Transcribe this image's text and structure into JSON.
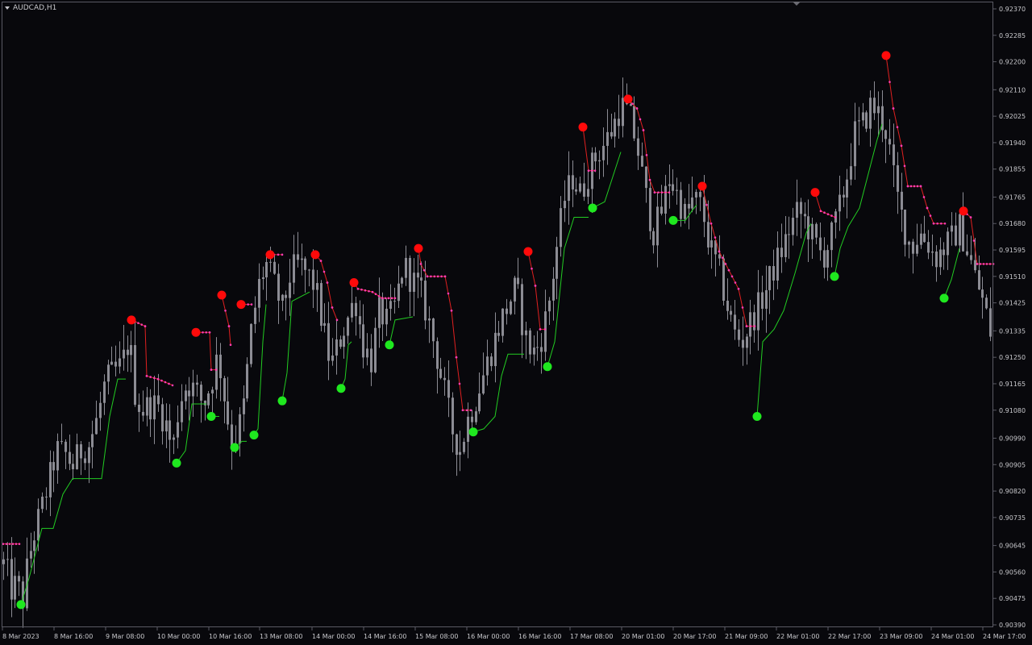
{
  "window": {
    "symbol_title": "AUDCAD,H1",
    "dropdown_icon": "triangle-down-icon"
  },
  "colors": {
    "background": "#08080c",
    "candle": "#8c8c94",
    "uptrend": "#22cc22",
    "downtrend": "#e02020",
    "dots": "#ff3db4",
    "signal_buy": "#1fe81f",
    "signal_sell": "#ff0a0a",
    "text": "#c8c8cc",
    "border": "#5a5a64"
  },
  "chart_data": {
    "type": "candlestick",
    "symbol": "AUDCAD",
    "timeframe": "H1",
    "ylim": [
      0.9039,
      0.9237
    ],
    "y_ticks": [
      "0.92370",
      "0.92285",
      "0.92200",
      "0.92110",
      "0.92025",
      "0.91940",
      "0.91855",
      "0.91765",
      "0.91680",
      "0.91595",
      "0.91510",
      "0.91425",
      "0.91335",
      "0.91250",
      "0.91165",
      "0.91080",
      "0.90990",
      "0.90905",
      "0.90820",
      "0.90735",
      "0.90645",
      "0.90560",
      "0.90475",
      "0.90390"
    ],
    "x_ticks": [
      "8 Mar 2023",
      "8 Mar 16:00",
      "9 Mar 08:00",
      "10 Mar 00:00",
      "10 Mar 16:00",
      "13 Mar 08:00",
      "14 Mar 00:00",
      "14 Mar 16:00",
      "15 Mar 08:00",
      "16 Mar 00:00",
      "16 Mar 16:00",
      "17 Mar 08:00",
      "20 Mar 01:00",
      "20 Mar 17:00",
      "21 Mar 09:00",
      "22 Mar 01:00",
      "22 Mar 17:00",
      "23 Mar 09:00",
      "24 Mar 01:00",
      "24 Mar 17:00"
    ],
    "price_path": [
      [
        0,
        0.9061
      ],
      [
        8,
        0.9056
      ],
      [
        14,
        0.905
      ],
      [
        20,
        0.9052
      ],
      [
        28,
        0.9047
      ],
      [
        34,
        0.9059
      ],
      [
        42,
        0.9068
      ],
      [
        50,
        0.9075
      ],
      [
        60,
        0.9085
      ],
      [
        70,
        0.9095
      ],
      [
        80,
        0.9094
      ],
      [
        90,
        0.909
      ],
      [
        100,
        0.9095
      ],
      [
        110,
        0.9097
      ],
      [
        120,
        0.9105
      ],
      [
        130,
        0.9117
      ],
      [
        140,
        0.912
      ],
      [
        150,
        0.9122
      ],
      [
        160,
        0.9131
      ],
      [
        168,
        0.9112
      ],
      [
        176,
        0.9108
      ],
      [
        186,
        0.911
      ],
      [
        196,
        0.9109
      ],
      [
        206,
        0.9103
      ],
      [
        214,
        0.9095
      ],
      [
        222,
        0.9111
      ],
      [
        232,
        0.9117
      ],
      [
        242,
        0.9114
      ],
      [
        252,
        0.911
      ],
      [
        262,
        0.9117
      ],
      [
        270,
        0.9126
      ],
      [
        278,
        0.9112
      ],
      [
        286,
        0.9099
      ],
      [
        294,
        0.91
      ],
      [
        302,
        0.911
      ],
      [
        312,
        0.9135
      ],
      [
        322,
        0.915
      ],
      [
        330,
        0.9155
      ],
      [
        340,
        0.9148
      ],
      [
        350,
        0.914
      ],
      [
        360,
        0.9152
      ],
      [
        370,
        0.9155
      ],
      [
        380,
        0.9152
      ],
      [
        390,
        0.9148
      ],
      [
        400,
        0.9135
      ],
      [
        410,
        0.9122
      ],
      [
        420,
        0.913
      ],
      [
        430,
        0.9137
      ],
      [
        440,
        0.9144
      ],
      [
        450,
        0.9129
      ],
      [
        460,
        0.9124
      ],
      [
        470,
        0.914
      ],
      [
        480,
        0.9136
      ],
      [
        490,
        0.9142
      ],
      [
        500,
        0.9155
      ],
      [
        510,
        0.915
      ],
      [
        520,
        0.9147
      ],
      [
        530,
        0.9138
      ],
      [
        540,
        0.9127
      ],
      [
        550,
        0.9115
      ],
      [
        560,
        0.9102
      ],
      [
        570,
        0.9095
      ],
      [
        580,
        0.9105
      ],
      [
        590,
        0.9112
      ],
      [
        600,
        0.912
      ],
      [
        610,
        0.9128
      ],
      [
        620,
        0.9136
      ],
      [
        630,
        0.9142
      ],
      [
        640,
        0.9148
      ],
      [
        650,
        0.9132
      ],
      [
        660,
        0.9126
      ],
      [
        670,
        0.913
      ],
      [
        680,
        0.9142
      ],
      [
        690,
        0.916
      ],
      [
        700,
        0.9176
      ],
      [
        710,
        0.9183
      ],
      [
        720,
        0.9177
      ],
      [
        730,
        0.9185
      ],
      [
        740,
        0.919
      ],
      [
        750,
        0.9194
      ],
      [
        760,
        0.9199
      ],
      [
        770,
        0.9206
      ],
      [
        780,
        0.9203
      ],
      [
        790,
        0.9193
      ],
      [
        800,
        0.9177
      ],
      [
        810,
        0.9165
      ],
      [
        820,
        0.9172
      ],
      [
        830,
        0.9183
      ],
      [
        840,
        0.9177
      ],
      [
        850,
        0.917
      ],
      [
        860,
        0.9176
      ],
      [
        870,
        0.9173
      ],
      [
        880,
        0.916
      ],
      [
        890,
        0.9154
      ],
      [
        900,
        0.9143
      ],
      [
        910,
        0.9133
      ],
      [
        920,
        0.913
      ],
      [
        930,
        0.9136
      ],
      [
        940,
        0.9141
      ],
      [
        950,
        0.9147
      ],
      [
        960,
        0.9154
      ],
      [
        970,
        0.916
      ],
      [
        980,
        0.9167
      ],
      [
        990,
        0.9172
      ],
      [
        1000,
        0.9168
      ],
      [
        1010,
        0.9162
      ],
      [
        1020,
        0.9157
      ],
      [
        1030,
        0.9163
      ],
      [
        1040,
        0.9172
      ],
      [
        1050,
        0.9183
      ],
      [
        1060,
        0.9197
      ],
      [
        1070,
        0.92
      ],
      [
        1080,
        0.9206
      ],
      [
        1090,
        0.9203
      ],
      [
        1100,
        0.9197
      ],
      [
        1110,
        0.9179
      ],
      [
        1120,
        0.9168
      ],
      [
        1130,
        0.916
      ],
      [
        1140,
        0.9165
      ],
      [
        1150,
        0.9162
      ],
      [
        1160,
        0.9157
      ],
      [
        1170,
        0.916
      ],
      [
        1180,
        0.9163
      ],
      [
        1190,
        0.9167
      ],
      [
        1200,
        0.9159
      ],
      [
        1210,
        0.915
      ],
      [
        1220,
        0.9142
      ],
      [
        1230,
        0.9131
      ]
    ],
    "trend_segments": [
      {
        "dir": "up",
        "points": [
          [
            26,
            0.90455
          ],
          [
            36,
            0.9054
          ],
          [
            52,
            0.907
          ],
          [
            66,
            0.907
          ],
          [
            78,
            0.9081
          ],
          [
            90,
            0.9086
          ],
          [
            112,
            0.9086
          ],
          [
            126,
            0.9086
          ],
          [
            136,
            0.9106
          ],
          [
            146,
            0.9118
          ],
          [
            156,
            0.9118
          ]
        ]
      },
      {
        "dir": "down",
        "points": [
          [
            4,
            0.9065
          ],
          [
            24,
            0.9065
          ]
        ]
      },
      {
        "dir": "down",
        "points": [
          [
            163,
            0.9137
          ],
          [
            180,
            0.9135
          ],
          [
            182,
            0.9119
          ],
          [
            196,
            0.9118
          ],
          [
            214,
            0.9116
          ]
        ]
      },
      {
        "dir": "up",
        "points": [
          [
            219,
            0.9091
          ],
          [
            230,
            0.9095
          ],
          [
            238,
            0.911
          ],
          [
            256,
            0.911
          ]
        ]
      },
      {
        "dir": "down",
        "points": [
          [
            243,
            0.9133
          ],
          [
            260,
            0.9133
          ],
          [
            262,
            0.9121
          ],
          [
            268,
            0.9121
          ]
        ]
      },
      {
        "dir": "up",
        "points": [
          [
            262,
            0.9106
          ],
          [
            272,
            0.9106
          ]
        ]
      },
      {
        "dir": "down",
        "points": [
          [
            275,
            0.9145
          ],
          [
            284,
            0.9135
          ],
          [
            286,
            0.9129
          ]
        ]
      },
      {
        "dir": "up",
        "points": [
          [
            291,
            0.9096
          ],
          [
            300,
            0.9098
          ],
          [
            306,
            0.9098
          ]
        ]
      },
      {
        "dir": "down",
        "points": [
          [
            299,
            0.9142
          ],
          [
            312,
            0.9142
          ]
        ]
      },
      {
        "dir": "up",
        "points": [
          [
            315,
            0.91
          ],
          [
            320,
            0.9102
          ],
          [
            326,
            0.913
          ],
          [
            330,
            0.9142
          ]
        ]
      },
      {
        "dir": "down",
        "points": [
          [
            335,
            0.9158
          ],
          [
            350,
            0.9158
          ]
        ]
      },
      {
        "dir": "up",
        "points": [
          [
            350,
            0.9111
          ],
          [
            356,
            0.912
          ],
          [
            362,
            0.9143
          ],
          [
            384,
            0.9146
          ]
        ]
      },
      {
        "dir": "down",
        "points": [
          [
            391,
            0.9158
          ],
          [
            398,
            0.9156
          ],
          [
            406,
            0.9149
          ],
          [
            412,
            0.9141
          ],
          [
            418,
            0.9137
          ]
        ]
      },
      {
        "dir": "up",
        "points": [
          [
            423,
            0.9115
          ],
          [
            428,
            0.9118
          ],
          [
            432,
            0.9129
          ],
          [
            436,
            0.913
          ]
        ]
      },
      {
        "dir": "down",
        "points": [
          [
            439,
            0.9149
          ],
          [
            444,
            0.9147
          ],
          [
            462,
            0.9146
          ],
          [
            474,
            0.9144
          ],
          [
            490,
            0.9144
          ]
        ]
      },
      {
        "dir": "up",
        "points": [
          [
            483,
            0.9129
          ],
          [
            490,
            0.9137
          ],
          [
            512,
            0.9138
          ]
        ]
      },
      {
        "dir": "down",
        "points": [
          [
            519,
            0.916
          ],
          [
            522,
            0.9155
          ],
          [
            530,
            0.9151
          ],
          [
            552,
            0.9151
          ],
          [
            560,
            0.914
          ],
          [
            566,
            0.9125
          ],
          [
            574,
            0.9108
          ],
          [
            584,
            0.9108
          ]
        ]
      },
      {
        "dir": "up",
        "points": [
          [
            587,
            0.9101
          ],
          [
            600,
            0.9102
          ],
          [
            614,
            0.9106
          ],
          [
            622,
            0.9119
          ],
          [
            630,
            0.9126
          ],
          [
            650,
            0.9126
          ]
        ]
      },
      {
        "dir": "down",
        "points": [
          [
            655,
            0.9159
          ],
          [
            664,
            0.9148
          ],
          [
            670,
            0.9134
          ],
          [
            676,
            0.9134
          ]
        ]
      },
      {
        "dir": "up",
        "points": [
          [
            679,
            0.9122
          ],
          [
            688,
            0.913
          ],
          [
            700,
            0.916
          ],
          [
            712,
            0.917
          ],
          [
            730,
            0.917
          ]
        ]
      },
      {
        "dir": "down",
        "points": [
          [
            723,
            0.9199
          ],
          [
            730,
            0.9185
          ],
          [
            738,
            0.9185
          ]
        ]
      },
      {
        "dir": "up",
        "points": [
          [
            735,
            0.9173
          ],
          [
            750,
            0.9175
          ],
          [
            760,
            0.9183
          ],
          [
            770,
            0.9191
          ]
        ]
      },
      {
        "dir": "down",
        "points": [
          [
            779,
            0.9208
          ],
          [
            790,
            0.9205
          ],
          [
            798,
            0.9198
          ],
          [
            806,
            0.9182
          ],
          [
            812,
            0.9178
          ],
          [
            830,
            0.9178
          ]
        ]
      },
      {
        "dir": "up",
        "points": [
          [
            835,
            0.9169
          ],
          [
            850,
            0.9169
          ],
          [
            858,
            0.9172
          ],
          [
            864,
            0.9174
          ]
        ]
      },
      {
        "dir": "down",
        "points": [
          [
            871,
            0.918
          ],
          [
            882,
            0.9168
          ],
          [
            892,
            0.9159
          ],
          [
            904,
            0.9153
          ],
          [
            916,
            0.9147
          ],
          [
            926,
            0.9135
          ],
          [
            936,
            0.9135
          ]
        ]
      },
      {
        "dir": "up",
        "points": [
          [
            939,
            0.9106
          ],
          [
            946,
            0.913
          ],
          [
            960,
            0.9134
          ],
          [
            972,
            0.914
          ],
          [
            986,
            0.9152
          ],
          [
            1000,
            0.9165
          ],
          [
            1006,
            0.9168
          ]
        ]
      },
      {
        "dir": "down",
        "points": [
          [
            1011,
            0.9178
          ],
          [
            1018,
            0.9172
          ],
          [
            1036,
            0.917
          ]
        ]
      },
      {
        "dir": "up",
        "points": [
          [
            1035,
            0.9151
          ],
          [
            1042,
            0.916
          ],
          [
            1052,
            0.9167
          ],
          [
            1066,
            0.9173
          ],
          [
            1078,
            0.9185
          ],
          [
            1088,
            0.9195
          ],
          [
            1094,
            0.92
          ]
        ]
      },
      {
        "dir": "down",
        "points": [
          [
            1099,
            0.9222
          ],
          [
            1108,
            0.9205
          ],
          [
            1118,
            0.9193
          ],
          [
            1126,
            0.918
          ],
          [
            1142,
            0.918
          ],
          [
            1150,
            0.9173
          ],
          [
            1158,
            0.9168
          ],
          [
            1172,
            0.9168
          ]
        ]
      },
      {
        "dir": "up",
        "points": [
          [
            1171,
            0.9144
          ],
          [
            1180,
            0.915
          ],
          [
            1190,
            0.916
          ]
        ]
      },
      {
        "dir": "down",
        "points": [
          [
            1195,
            0.9172
          ],
          [
            1204,
            0.917
          ],
          [
            1212,
            0.9155
          ],
          [
            1232,
            0.9155
          ]
        ]
      }
    ],
    "buy_signals": [
      [
        26,
        0.90455
      ],
      [
        219,
        0.9091
      ],
      [
        262,
        0.9106
      ],
      [
        291,
        0.9096
      ],
      [
        315,
        0.91
      ],
      [
        350,
        0.9111
      ],
      [
        423,
        0.9115
      ],
      [
        483,
        0.9129
      ],
      [
        587,
        0.9101
      ],
      [
        679,
        0.9122
      ],
      [
        735,
        0.9173
      ],
      [
        835,
        0.9169
      ],
      [
        939,
        0.9106
      ],
      [
        1035,
        0.9151
      ],
      [
        1171,
        0.9144
      ]
    ],
    "sell_signals": [
      [
        163,
        0.9137
      ],
      [
        243,
        0.9133
      ],
      [
        275,
        0.9145
      ],
      [
        299,
        0.9142
      ],
      [
        335,
        0.9158
      ],
      [
        391,
        0.9158
      ],
      [
        439,
        0.9149
      ],
      [
        519,
        0.916
      ],
      [
        655,
        0.9159
      ],
      [
        723,
        0.9199
      ],
      [
        779,
        0.9208
      ],
      [
        871,
        0.918
      ],
      [
        1011,
        0.9178
      ],
      [
        1099,
        0.9222
      ],
      [
        1195,
        0.9172
      ]
    ]
  }
}
